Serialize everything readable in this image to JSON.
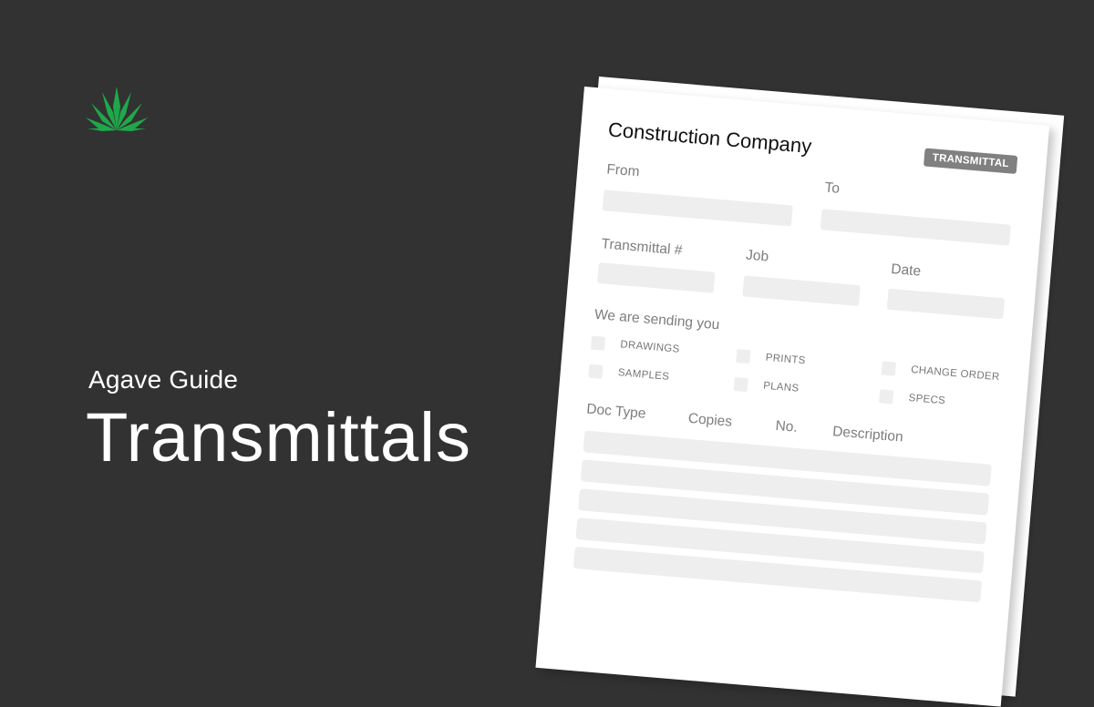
{
  "brand": {
    "logo_icon": "agave-plant-icon",
    "accent_color": "#1fa84a"
  },
  "hero": {
    "eyebrow": "Agave Guide",
    "title": "Transmittals"
  },
  "document": {
    "company": "Construction Company",
    "badge": "TRANSMITTAL",
    "labels": {
      "from": "From",
      "to": "To",
      "transmittal_no": "Transmittal #",
      "job": "Job",
      "date": "Date",
      "sending": "We are sending you"
    },
    "checkboxes": [
      {
        "label": "DRAWINGS",
        "checked": false
      },
      {
        "label": "SAMPLES",
        "checked": false
      },
      {
        "label": "PRINTS",
        "checked": false
      },
      {
        "label": "PLANS",
        "checked": false
      },
      {
        "label": "CHANGE ORDER",
        "checked": false
      },
      {
        "label": "SPECS",
        "checked": false
      }
    ],
    "table": {
      "columns": [
        "Doc Type",
        "Copies",
        "No.",
        "Description"
      ],
      "rows": [
        "",
        "",
        "",
        "",
        ""
      ]
    },
    "colors": {
      "field": "#eeeeee",
      "badge": "#808080",
      "label": "#7d7d7d"
    }
  }
}
